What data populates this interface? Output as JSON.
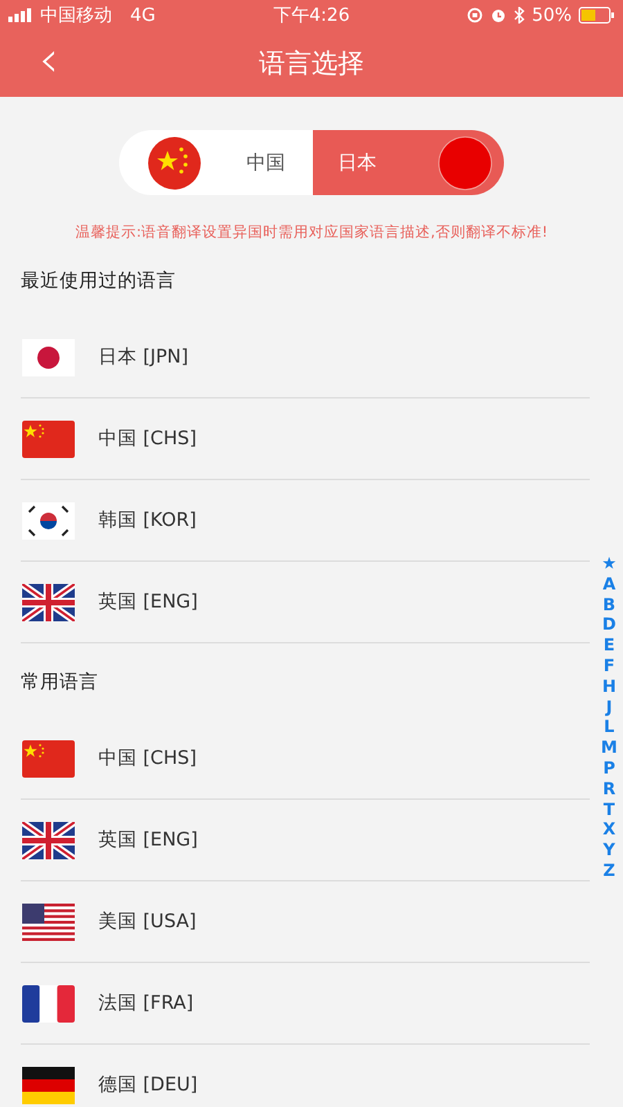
{
  "status_bar": {
    "carrier": "中国移动",
    "network": "4G",
    "time": "下午4:26",
    "battery": "50%"
  },
  "header": {
    "back": "‹",
    "title": "语言选择"
  },
  "switcher": [
    {
      "label": "中国",
      "kind": "cn",
      "selected": false
    },
    {
      "label": "日本",
      "kind": "jp",
      "selected": true
    }
  ],
  "hint": "温馨提示:语音翻译设置异国时需用对应国家语言描述,否则翻译不标准!",
  "sections": [
    {
      "title": "最近使用过的语言",
      "items": [
        {
          "label": "日本 [JPN]",
          "kind": "jp"
        },
        {
          "label": "中国 [CHS]",
          "kind": "cn"
        },
        {
          "label": "韩国 [KOR]",
          "kind": "kr"
        },
        {
          "label": "英国 [ENG]",
          "kind": "gb"
        }
      ]
    },
    {
      "title": "常用语言",
      "items": [
        {
          "label": "中国 [CHS]",
          "kind": "cn"
        },
        {
          "label": "英国 [ENG]",
          "kind": "gb"
        },
        {
          "label": "美国 [USA]",
          "kind": "us"
        },
        {
          "label": "法国 [FRA]",
          "kind": "fr"
        },
        {
          "label": "德国 [DEU]",
          "kind": "de"
        }
      ]
    }
  ],
  "index": [
    "★",
    "A",
    "B",
    "D",
    "E",
    "F",
    "H",
    "J",
    "L",
    "M",
    "P",
    "R",
    "T",
    "X",
    "Y",
    "Z"
  ]
}
